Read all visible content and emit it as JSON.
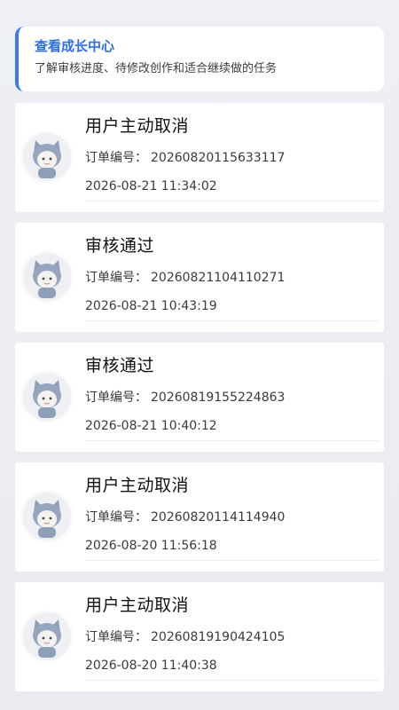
{
  "banner": {
    "title": "查看成长中心",
    "subtitle": "了解审核进度、待修改创作和适合继续做的任务"
  },
  "orders": [
    {
      "status": "用户主动取消",
      "order_label": "订单编号：",
      "order_no": "20260820115633117",
      "time": "2026-08-21 11:34:02",
      "avatar_icon": "cat-kid-avatar-icon"
    },
    {
      "status": "审核通过",
      "order_label": "订单编号：",
      "order_no": "20260821104110271",
      "time": "2026-08-21 10:43:19",
      "avatar_icon": "cat-kid-avatar-icon"
    },
    {
      "status": "审核通过",
      "order_label": "订单编号：",
      "order_no": "20260819155224863",
      "time": "2026-08-21 10:40:12",
      "avatar_icon": "cat-kid-avatar-icon"
    },
    {
      "status": "用户主动取消",
      "order_label": "订单编号：",
      "order_no": "20260820114114940",
      "time": "2026-08-20 11:56:18",
      "avatar_icon": "cat-kid-avatar-icon"
    },
    {
      "status": "用户主动取消",
      "order_label": "订单编号：",
      "order_no": "20260819190424105",
      "time": "2026-08-20 11:40:38",
      "avatar_icon": "cat-kid-avatar-icon"
    }
  ],
  "colors": {
    "accent": "#2d6fe8",
    "card_bg": "#ffffff",
    "page_bg": "#eceef3"
  }
}
